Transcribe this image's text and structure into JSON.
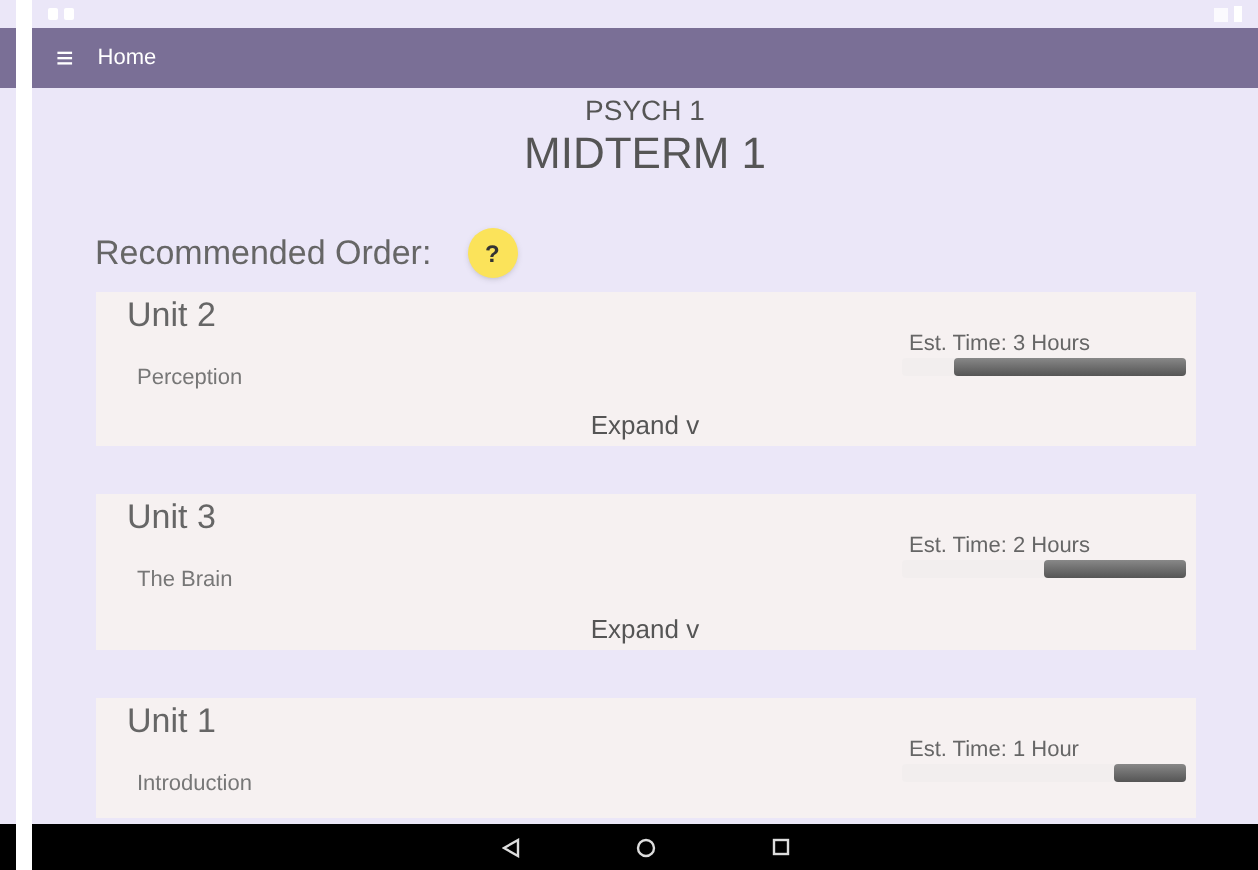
{
  "app_bar": {
    "menu_icon": "≡",
    "title": "Home"
  },
  "header": {
    "course": "PSYCH 1",
    "exam": "MIDTERM 1"
  },
  "section": {
    "title": "Recommended Order:",
    "help": "?"
  },
  "units": [
    {
      "name": "Unit 2",
      "topic": "Perception",
      "estimate": "Est. Time: 3 Hours",
      "level": 0.81,
      "expand": "Expand v"
    },
    {
      "name": "Unit 3",
      "topic": "The Brain",
      "estimate": "Est. Time: 2 Hours",
      "level": 0.5,
      "expand": "Expand v"
    },
    {
      "name": "Unit 1",
      "topic": "Introduction",
      "estimate": "Est. Time: 1 Hour",
      "level": 0.25
    }
  ]
}
